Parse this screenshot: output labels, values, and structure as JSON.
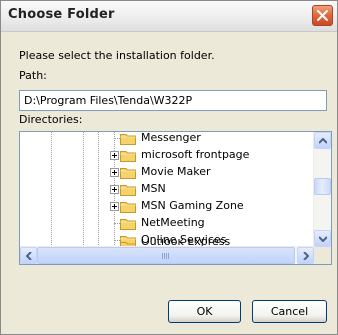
{
  "window": {
    "title": "Choose Folder"
  },
  "prompt": "Please select the installation folder.",
  "path": {
    "label": "Path:",
    "value": "D:\\Program Files\\Tenda\\W322P"
  },
  "directories": {
    "label": "Directories:",
    "items": [
      {
        "label": "Messenger",
        "expandable": false
      },
      {
        "label": "microsoft frontpage",
        "expandable": true
      },
      {
        "label": "Movie Maker",
        "expandable": true
      },
      {
        "label": "MSN",
        "expandable": true
      },
      {
        "label": "MSN Gaming Zone",
        "expandable": true
      },
      {
        "label": "NetMeeting",
        "expandable": false
      },
      {
        "label": "Online Services",
        "expandable": false
      },
      {
        "label": "Outlook Express",
        "expandable": false
      }
    ]
  },
  "buttons": {
    "ok": "OK",
    "cancel": "Cancel"
  },
  "icons": {
    "close": "close-icon",
    "folder": "folder-icon",
    "expander": "plus-expander-icon",
    "scroll_up": "arrow-up-icon",
    "scroll_down": "arrow-down-icon",
    "scroll_left": "arrow-left-icon",
    "scroll_right": "arrow-right-icon"
  },
  "colors": {
    "dialog_bg": "#ece9d8",
    "close_button": "#e06b3f",
    "input_border": "#7f9db9",
    "folder_yellow": "#f6d26b",
    "button_border": "#003c74"
  }
}
